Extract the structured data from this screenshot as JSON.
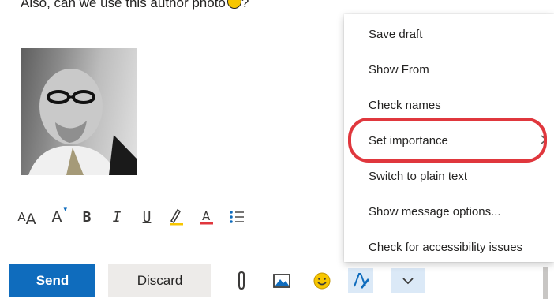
{
  "compose": {
    "body_text": "Also, can we use this author photo",
    "body_text_end": "?",
    "photo_alt": "author photo",
    "format_toolbar": [
      {
        "name": "font-size-icon",
        "glyph": "AA"
      },
      {
        "name": "grow-font-icon",
        "glyph": "A"
      },
      {
        "name": "bold-icon",
        "glyph": "B"
      },
      {
        "name": "italic-icon",
        "glyph": "I"
      },
      {
        "name": "underline-icon",
        "glyph": "U"
      },
      {
        "name": "highlight-icon",
        "glyph": "A"
      },
      {
        "name": "font-color-icon",
        "glyph": "A"
      },
      {
        "name": "bullets-icon",
        "glyph": ""
      }
    ]
  },
  "actions": {
    "send_label": "Send",
    "discard_label": "Discard",
    "tools": [
      "attach-icon",
      "insert-picture-icon",
      "emoji-icon",
      "formatting-icon",
      "more-options-chevron-icon"
    ]
  },
  "menu": {
    "items": [
      {
        "label": "Save draft",
        "has_submenu": false
      },
      {
        "label": "Show From",
        "has_submenu": false
      },
      {
        "label": "Check names",
        "has_submenu": false
      },
      {
        "label": "Set importance",
        "has_submenu": true,
        "highlighted": true
      },
      {
        "label": "Switch to plain text",
        "has_submenu": false
      },
      {
        "label": "Show message options...",
        "has_submenu": false
      },
      {
        "label": "Check for accessibility issues",
        "has_submenu": false
      }
    ]
  },
  "colors": {
    "accent": "#0f6cbd",
    "highlight_ring": "#e0373d",
    "active_tool_bg": "#dbe9f7",
    "font_color_underline": "#e0373d",
    "highlight_pen": "#f7c600"
  }
}
